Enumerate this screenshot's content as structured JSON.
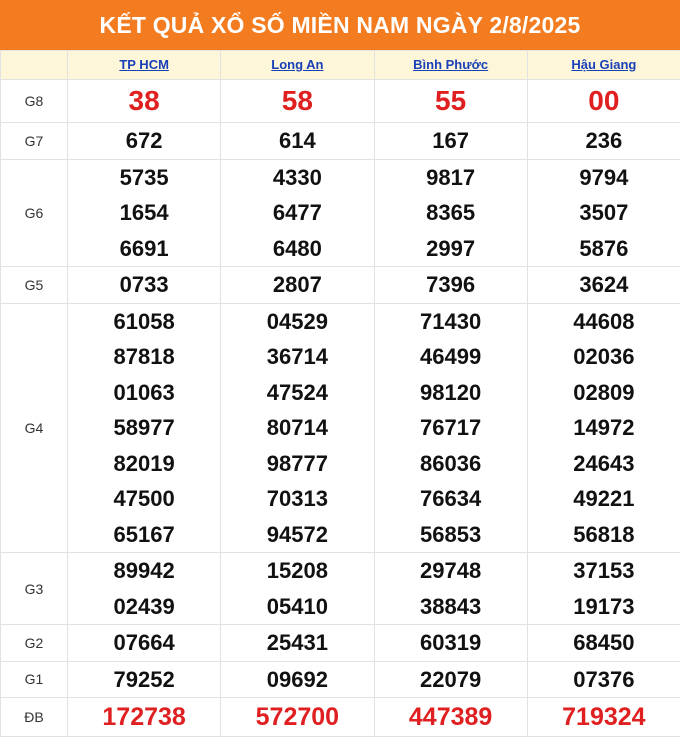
{
  "title": "KẾT QUẢ XỔ SỐ MIỀN NAM NGÀY 2/8/2025",
  "provinces": [
    "TP HCM",
    "Long An",
    "Bình Phước",
    "Hậu Giang"
  ],
  "prizes": [
    {
      "label": "G8",
      "key": "g8",
      "values": [
        [
          "38"
        ],
        [
          "58"
        ],
        [
          "55"
        ],
        [
          "00"
        ]
      ]
    },
    {
      "label": "G7",
      "key": "g7",
      "values": [
        [
          "672"
        ],
        [
          "614"
        ],
        [
          "167"
        ],
        [
          "236"
        ]
      ]
    },
    {
      "label": "G6",
      "key": "g6",
      "values": [
        [
          "5735",
          "1654",
          "6691"
        ],
        [
          "4330",
          "6477",
          "6480"
        ],
        [
          "9817",
          "8365",
          "2997"
        ],
        [
          "9794",
          "3507",
          "5876"
        ]
      ]
    },
    {
      "label": "G5",
      "key": "g5",
      "values": [
        [
          "0733"
        ],
        [
          "2807"
        ],
        [
          "7396"
        ],
        [
          "3624"
        ]
      ]
    },
    {
      "label": "G4",
      "key": "g4",
      "values": [
        [
          "61058",
          "87818",
          "01063",
          "58977",
          "82019",
          "47500",
          "65167"
        ],
        [
          "04529",
          "36714",
          "47524",
          "80714",
          "98777",
          "70313",
          "94572"
        ],
        [
          "71430",
          "46499",
          "98120",
          "76717",
          "86036",
          "76634",
          "56853"
        ],
        [
          "44608",
          "02036",
          "02809",
          "14972",
          "24643",
          "49221",
          "56818"
        ]
      ]
    },
    {
      "label": "G3",
      "key": "g3",
      "values": [
        [
          "89942",
          "02439"
        ],
        [
          "15208",
          "05410"
        ],
        [
          "29748",
          "38843"
        ],
        [
          "37153",
          "19173"
        ]
      ]
    },
    {
      "label": "G2",
      "key": "g2",
      "values": [
        [
          "07664"
        ],
        [
          "25431"
        ],
        [
          "60319"
        ],
        [
          "68450"
        ]
      ]
    },
    {
      "label": "G1",
      "key": "g1",
      "values": [
        [
          "79252"
        ],
        [
          "09692"
        ],
        [
          "22079"
        ],
        [
          "07376"
        ]
      ]
    },
    {
      "label": "ĐB",
      "key": "db",
      "values": [
        [
          "172738"
        ],
        [
          "572700"
        ],
        [
          "447389"
        ],
        [
          "719324"
        ]
      ]
    }
  ],
  "colors": {
    "header_bg": "#f47c20",
    "province_row_bg": "#fdf6d8",
    "province_link": "#1a40b8",
    "highlight_number": "#e02020"
  }
}
